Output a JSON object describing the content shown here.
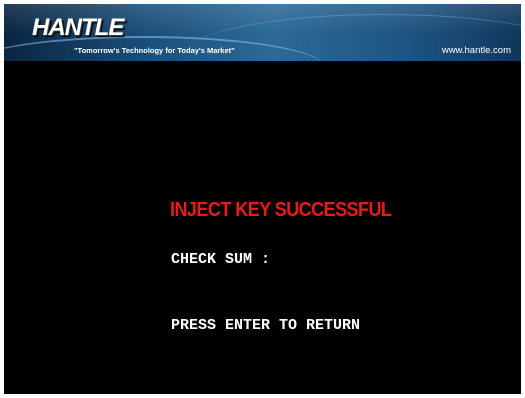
{
  "header": {
    "logo_text": "HANTLE",
    "tagline": "\"Tomorrow's Technology for Today's Market\"",
    "website": "www.hantle.com"
  },
  "main": {
    "status_title": "INJECT KEY SUCCESSFUL",
    "checksum_label": "CHECK SUM :",
    "checksum_value": "",
    "instruction": "PRESS ENTER TO RETURN"
  },
  "colors": {
    "background": "#000000",
    "banner": "#1b4f7a",
    "status_title": "#e81a1a",
    "text": "#ffffff"
  }
}
